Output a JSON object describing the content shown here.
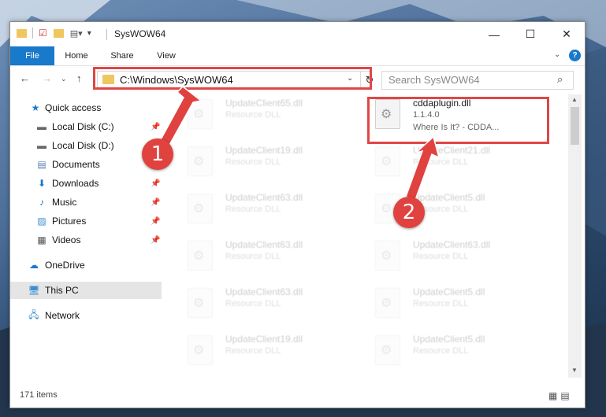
{
  "window": {
    "title": "SysWOW64"
  },
  "ribbon": {
    "tabs": [
      "File",
      "Home",
      "Share",
      "View"
    ],
    "help_icon": "?"
  },
  "address": {
    "path": "C:\\Windows\\SysWOW64"
  },
  "search": {
    "placeholder": "Search SysWOW64"
  },
  "sidebar": {
    "quick_access": "Quick access",
    "items": [
      {
        "label": "Local Disk (C:)",
        "icon": "drive-icon",
        "pinned": true
      },
      {
        "label": "Local Disk (D:)",
        "icon": "drive-icon",
        "pinned": false
      },
      {
        "label": "Documents",
        "icon": "documents-icon",
        "pinned": true
      },
      {
        "label": "Downloads",
        "icon": "downloads-icon",
        "pinned": true
      },
      {
        "label": "Music",
        "icon": "music-icon",
        "pinned": true
      },
      {
        "label": "Pictures",
        "icon": "pictures-icon",
        "pinned": true
      },
      {
        "label": "Videos",
        "icon": "videos-icon",
        "pinned": true
      }
    ],
    "onedrive": "OneDrive",
    "this_pc": "This PC",
    "network": "Network"
  },
  "files": {
    "left_column": [
      {
        "name": "UpdateClient65.dll",
        "type": "Resource DLL"
      },
      {
        "name": "UpdateClient19.dll",
        "type": "Resource DLL"
      },
      {
        "name": "UpdateClient63.dll",
        "type": "Resource DLL"
      },
      {
        "name": "UpdateClient63.dll",
        "type": "Resource DLL"
      },
      {
        "name": "UpdateClient63.dll",
        "type": "Resource DLL"
      },
      {
        "name": "UpdateClient19.dll",
        "type": "Resource DLL"
      }
    ],
    "right_column": [
      {
        "name": "cddaplugin.dll",
        "type": "1.1.4.0",
        "desc": "Where Is It? - CDDA..."
      },
      {
        "name": "UpdateClient21.dll",
        "type": "Resource DLL"
      },
      {
        "name": "UpdateClient5.dll",
        "type": "Resource DLL"
      },
      {
        "name": "UpdateClient63.dll",
        "type": "Resource DLL"
      },
      {
        "name": "UpdateClient5.dll",
        "type": "Resource DLL"
      },
      {
        "name": "UpdateClient5.dll",
        "type": "Resource DLL"
      }
    ]
  },
  "status": {
    "item_count": "171 items"
  },
  "annotations": {
    "step1": "1",
    "step2": "2"
  },
  "colors": {
    "accent": "#1979ca",
    "highlight": "#e04646",
    "badge": "#e0423f"
  }
}
